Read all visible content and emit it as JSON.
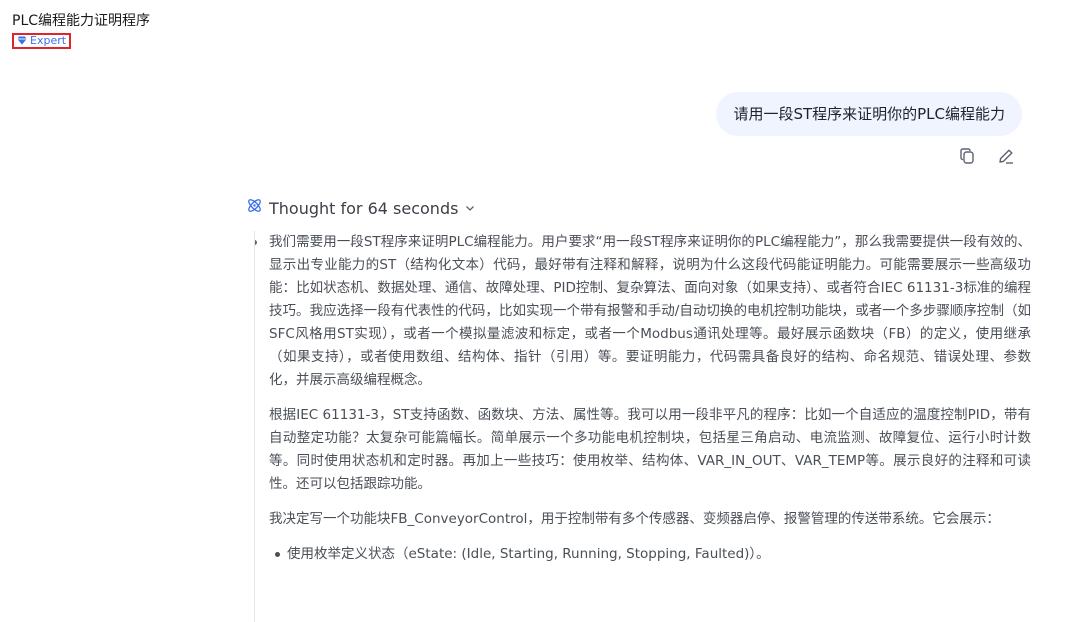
{
  "header": {
    "title": "PLC编程能力证明程序",
    "model_badge": "Expert",
    "badge_icon": "diamond-icon",
    "badge_color": "#3b6fe6"
  },
  "user_message": {
    "text": "请用一段ST程序来证明你的PLC编程能力",
    "bubble_color": "#eff4ff"
  },
  "message_actions": {
    "copy_icon": "copy-icon",
    "edit_icon": "edit-icon"
  },
  "thought": {
    "label": "Thought for 64 seconds",
    "icon": "atom-icon",
    "toggle_icon": "chevron-down-icon",
    "paragraphs": [
      "我们需要用一段ST程序来证明PLC编程能力。用户要求“用一段ST程序来证明你的PLC编程能力”，那么我需要提供一段有效的、显示出专业能力的ST（结构化文本）代码，最好带有注释和解释，说明为什么这段代码能证明能力。可能需要展示一些高级功能：比如状态机、数据处理、通信、故障处理、PID控制、复杂算法、面向对象（如果支持）、或者符合IEC 61131-3标准的编程技巧。我应选择一段有代表性的代码，比如实现一个带有报警和手动/自动切换的电机控制功能块，或者一个多步骤顺序控制（如SFC风格用ST实现），或者一个模拟量滤波和标定，或者一个Modbus通讯处理等。最好展示函数块（FB）的定义，使用继承（如果支持），或者使用数组、结构体、指针（引用）等。要证明能力，代码需具备良好的结构、命名规范、错误处理、参数化，并展示高级编程概念。",
      "根据IEC 61131-3，ST支持函数、函数块、方法、属性等。我可以用一段非平凡的程序：比如一个自适应的温度控制PID，带有自动整定功能？太复杂可能篇幅长。简单展示一个多功能电机控制块，包括星三角启动、电流监测、故障复位、运行小时计数等。同时使用状态机和定时器。再加上一些技巧：使用枚举、结构体、VAR_IN_OUT、VAR_TEMP等。展示良好的注释和可读性。还可以包括跟踪功能。",
      "我决定写一个功能块FB_ConveyorControl，用于控制带有多个传感器、变频器启停、报警管理的传送带系统。它会展示："
    ],
    "sub_items": [
      "使用枚举定义状态（eState: (Idle, Starting, Running, Stopping, Faulted)）。"
    ]
  }
}
